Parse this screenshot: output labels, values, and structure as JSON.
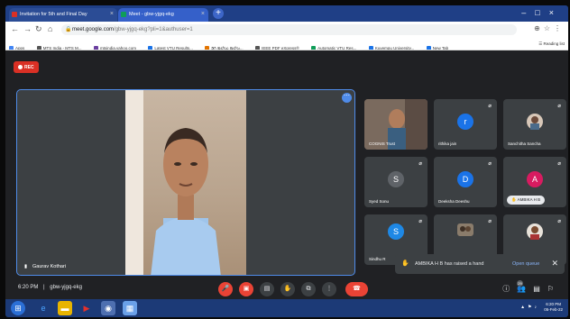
{
  "browser": {
    "tabs": [
      {
        "title": "Invitation for 5th and Final Day",
        "favicon_color": "#d93025"
      },
      {
        "title": "Meet - gbw-yjgq-ekg",
        "favicon_color": "#0f9d58"
      }
    ],
    "new_tab": "+",
    "url_host": "meet.google.com",
    "url_path": "/gbw-yjgq-ekg?pli=1&authuser=1",
    "bookmarks": [
      {
        "label": "Apps",
        "color": "#4285f4"
      },
      {
        "label": "MTS India - MTS M...",
        "color": "#555555"
      },
      {
        "label": "mtsindia.yahoo.com",
        "color": "#6b3fa0"
      },
      {
        "label": "Latest VTU Results...",
        "color": "#1a73e8"
      },
      {
        "label": "ಡಿಗ್ರಿ ಕಾಲೇಜು ಕಾಲೇಜ...",
        "color": "#e37400"
      },
      {
        "label": "IEEE PDF eXpress®",
        "color": "#555555"
      },
      {
        "label": "Automatic VTU Res...",
        "color": "#0f9d58"
      },
      {
        "label": "Kuvempu University...",
        "color": "#1a73e8"
      },
      {
        "label": "New Tab",
        "color": "#1a73e8"
      }
    ],
    "reading_list": "Reading list"
  },
  "meet": {
    "rec_label": "REC",
    "main": {
      "name": "Gaurav Kothari"
    },
    "participants": [
      {
        "name": "COGNIS Trust",
        "avatar": "",
        "avatar_color": "#3c4043",
        "is_video": true
      },
      {
        "name": "rithika jain",
        "avatar": "r",
        "avatar_color": "#1a73e8",
        "is_video": false
      },
      {
        "name": "Sanchitha Sancha",
        "avatar": "",
        "avatar_color": "#3c4043",
        "is_video": true
      },
      {
        "name": "Syed Sonu",
        "avatar": "S",
        "avatar_color": "#5f6368",
        "is_video": false
      },
      {
        "name": "Deeksha Deeshu",
        "avatar": "D",
        "avatar_color": "#1a73e8",
        "is_video": false
      },
      {
        "name": "AMBIKA H B",
        "avatar": "A",
        "avatar_color": "#d81b60",
        "is_video": false
      },
      {
        "name": "Sindhu R",
        "avatar": "S",
        "avatar_color": "#1e88e5",
        "is_video": false
      },
      {
        "name": "",
        "avatar": "",
        "avatar_color": "#3c4043",
        "is_video": true
      },
      {
        "name": "",
        "avatar": "",
        "avatar_color": "#3c4043",
        "is_video": true
      }
    ],
    "toast": {
      "message": "AMBIKA H B has raised a hand",
      "action": "Open queue"
    },
    "bottom": {
      "time": "6:20 PM",
      "separator": "|",
      "meeting_code": "gbw-yjgq-ekg",
      "people_count": "29"
    }
  },
  "taskbar": {
    "time": "6:20 PM",
    "date": "05-Feb-22"
  }
}
